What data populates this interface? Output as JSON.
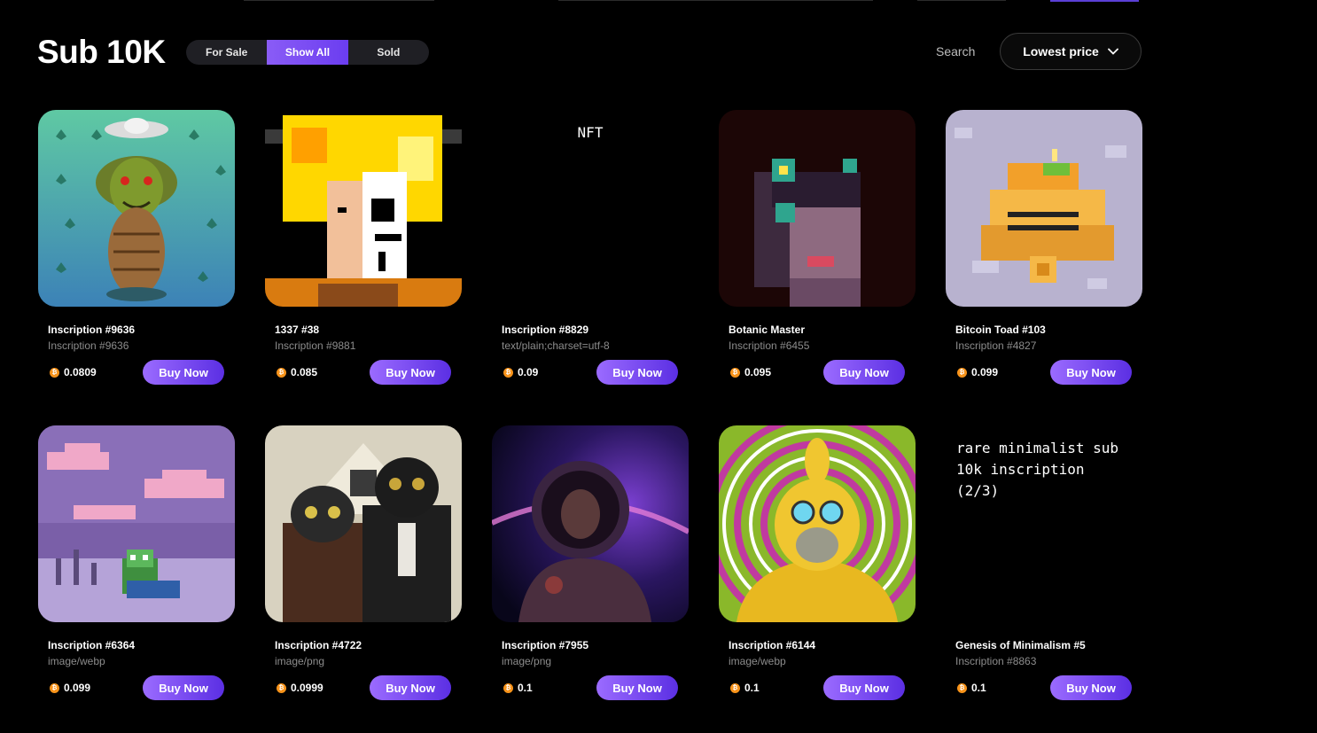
{
  "page": {
    "title": "Sub 10K"
  },
  "filters": [
    {
      "label": "For Sale",
      "active": false
    },
    {
      "label": "Show All",
      "active": true
    },
    {
      "label": "Sold",
      "active": false
    }
  ],
  "search": {
    "label": "Search"
  },
  "sort": {
    "label": "Lowest price"
  },
  "buy_label": "Buy Now",
  "currency_icon": "bitcoin-coin-icon",
  "colors": {
    "accent": "#7a4cf4",
    "bitcoin": "#f7931a",
    "background": "#000000"
  },
  "cards": [
    {
      "name": "Inscription #9636",
      "sub": "Inscription #9636",
      "price": "0.0809",
      "art": "goblin-figure"
    },
    {
      "name": "1337 #38",
      "sub": "Inscription #9881",
      "price": "0.085",
      "art": "pixel-skull-hair"
    },
    {
      "name": "Inscription #8829",
      "sub": "text/plain;charset=utf-8",
      "price": "0.09",
      "art_text": "NFT"
    },
    {
      "name": "Botanic Master",
      "sub": "Inscription #6455",
      "price": "0.095",
      "art": "pixel-girl-flowers"
    },
    {
      "name": "Bitcoin Toad #103",
      "sub": "Inscription #4827",
      "price": "0.099",
      "art": "pixel-toad"
    },
    {
      "name": "Inscription #6364",
      "sub": "image/webp",
      "price": "0.099",
      "art": "pixel-pepe-sunset"
    },
    {
      "name": "Inscription #4722",
      "sub": "image/png",
      "price": "0.0999",
      "art": "cats-gothic"
    },
    {
      "name": "Inscription #7955",
      "sub": "image/png",
      "price": "0.1",
      "art": "astronaut-space"
    },
    {
      "name": "Inscription #6144",
      "sub": "image/webp",
      "price": "0.1",
      "art": "golden-ape"
    },
    {
      "name": "Genesis of Minimalism #5",
      "sub": "Inscription #8863",
      "price": "0.1",
      "art_text": "rare minimalist sub 10k inscription (2/3)"
    }
  ]
}
